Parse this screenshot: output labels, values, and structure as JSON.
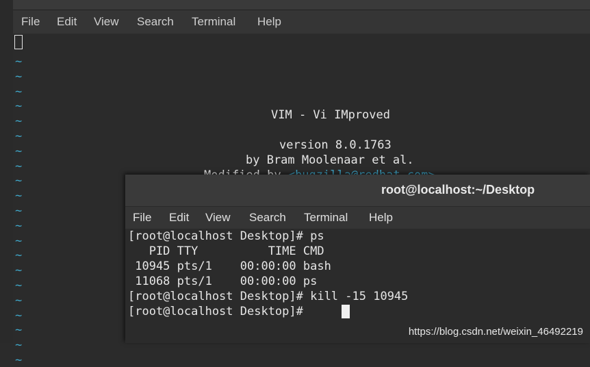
{
  "back_window": {
    "menu": [
      "File",
      "Edit",
      "View",
      "Search",
      "Terminal",
      "Help"
    ],
    "vim_intro": {
      "title": "VIM - Vi IMproved",
      "version": "version 8.0.1763",
      "author": "by Bram Moolenaar et al.",
      "modified_by_prefix": "Modified by ",
      "modified_by_email": "<bugzilla@redhat.com>"
    },
    "tilde": "~"
  },
  "front_window": {
    "title": "root@localhost:~/Desktop",
    "menu": [
      "File",
      "Edit",
      "View",
      "Search",
      "Terminal",
      "Help"
    ],
    "lines": [
      "[root@localhost Desktop]# ps",
      "   PID TTY          TIME CMD",
      " 10945 pts/1    00:00:00 bash",
      " 11068 pts/1    00:00:00 ps",
      "[root@localhost Desktop]# kill -15 10945",
      "[root@localhost Desktop]# "
    ]
  },
  "watermark": "https://blog.csdn.net/weixin_46492219",
  "colors": {
    "tilde": "#3fa6c8",
    "text": "#e6e6e6",
    "background": "#2b2b2b"
  }
}
